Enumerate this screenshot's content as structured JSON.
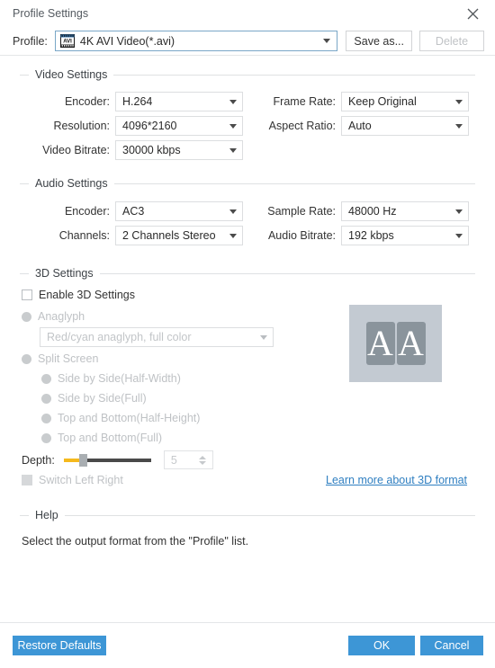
{
  "window": {
    "title": "Profile Settings",
    "close_icon": "close-icon"
  },
  "profile": {
    "label": "Profile:",
    "icon": "avi-file-icon",
    "value": "4K AVI Video(*.avi)",
    "save_as_label": "Save as...",
    "delete_label": "Delete"
  },
  "video_settings": {
    "title": "Video Settings",
    "encoder_label": "Encoder:",
    "encoder_value": "H.264",
    "resolution_label": "Resolution:",
    "resolution_value": "4096*2160",
    "video_bitrate_label": "Video Bitrate:",
    "video_bitrate_value": "30000 kbps",
    "frame_rate_label": "Frame Rate:",
    "frame_rate_value": "Keep Original",
    "aspect_ratio_label": "Aspect Ratio:",
    "aspect_ratio_value": "Auto"
  },
  "audio_settings": {
    "title": "Audio Settings",
    "encoder_label": "Encoder:",
    "encoder_value": "AC3",
    "channels_label": "Channels:",
    "channels_value": "2 Channels Stereo",
    "sample_rate_label": "Sample Rate:",
    "sample_rate_value": "48000 Hz",
    "audio_bitrate_label": "Audio Bitrate:",
    "audio_bitrate_value": "192 kbps"
  },
  "three_d_settings": {
    "title": "3D Settings",
    "enable_label": "Enable 3D Settings",
    "anaglyph_label": "Anaglyph",
    "anaglyph_value": "Red/cyan anaglyph, full color",
    "split_screen_label": "Split Screen",
    "side_by_side_half_label": "Side by Side(Half-Width)",
    "side_by_side_full_label": "Side by Side(Full)",
    "top_bottom_half_label": "Top and Bottom(Half-Height)",
    "top_bottom_full_label": "Top and Bottom(Full)",
    "depth_label": "Depth:",
    "depth_value": "5",
    "switch_left_right_label": "Switch Left Right",
    "learn_more_label": "Learn more about 3D format",
    "preview_left_letter": "A",
    "preview_right_letter": "A"
  },
  "help": {
    "title": "Help",
    "text": "Select the output format from the \"Profile\" list."
  },
  "footer": {
    "restore_defaults_label": "Restore Defaults",
    "ok_label": "OK",
    "cancel_label": "Cancel"
  },
  "colors": {
    "accent": "#3d96d6",
    "link": "#2f7fc1",
    "slider_fill": "#f5b91d",
    "focus_border": "#7aa7c7"
  }
}
